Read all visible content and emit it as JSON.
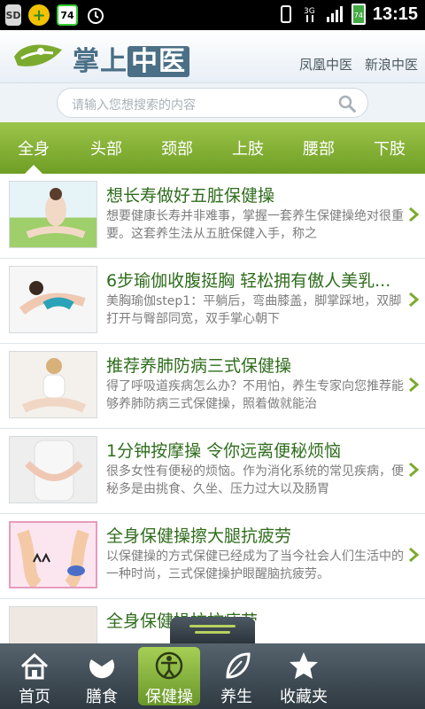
{
  "status": {
    "time": "13:15",
    "notif_badge": "74",
    "battery_level": "74"
  },
  "header": {
    "brand_part1": "掌上",
    "brand_part2": "中医",
    "links": [
      "凤凰中医",
      "新浪中医"
    ]
  },
  "search": {
    "placeholder": "请输入您想搜索的内容"
  },
  "tabs": [
    "全身",
    "头部",
    "颈部",
    "上肢",
    "腰部",
    "下肢"
  ],
  "active_tab": "全身",
  "articles": [
    {
      "title": "想长寿做好五脏保健操",
      "desc": "想要健康长寿并非难事，掌握一套养生保健操绝对很重要。这套养生法从五脏保健入手，称之"
    },
    {
      "title": "6步瑜伽收腹挺胸 轻松拥有傲人美乳...",
      "desc": "美胸瑜伽step1：平躺后，弯曲膝盖，脚掌踩地，双脚打开与臀部同宽，双手掌心朝下"
    },
    {
      "title": "推荐养肺防病三式保健操",
      "desc": "得了呼吸道疾病怎么办？不用怕，养生专家向您推荐能够养肺防病三式保健操，照着做就能治"
    },
    {
      "title": "1分钟按摩操 令你远离便秘烦恼",
      "desc": "很多女性有便秘的烦恼。作为消化系统的常见疾病，便秘多是由挑食、久坐、压力过大以及肠胃"
    },
    {
      "title": "全身保健操擦大腿抗疲劳",
      "desc": "以保健操的方式保健已经成为了当今社会人们生活中的一种时尚，三式保健操护眼醒脑抗疲劳。"
    },
    {
      "title": "全身保健操拉抗疲劳",
      "desc": ""
    }
  ],
  "bottom_nav": [
    {
      "label": "首页",
      "icon": "home-icon"
    },
    {
      "label": "膳食",
      "icon": "bowl-icon"
    },
    {
      "label": "保健操",
      "icon": "exercise-icon"
    },
    {
      "label": "养生",
      "icon": "leaf-icon"
    },
    {
      "label": "收藏夹",
      "icon": "star-icon"
    }
  ],
  "active_nav": "保健操",
  "colors": {
    "accent_green": "#7bab2e",
    "title_green": "#2f6d1c",
    "brand_blue": "#4a6f86"
  }
}
